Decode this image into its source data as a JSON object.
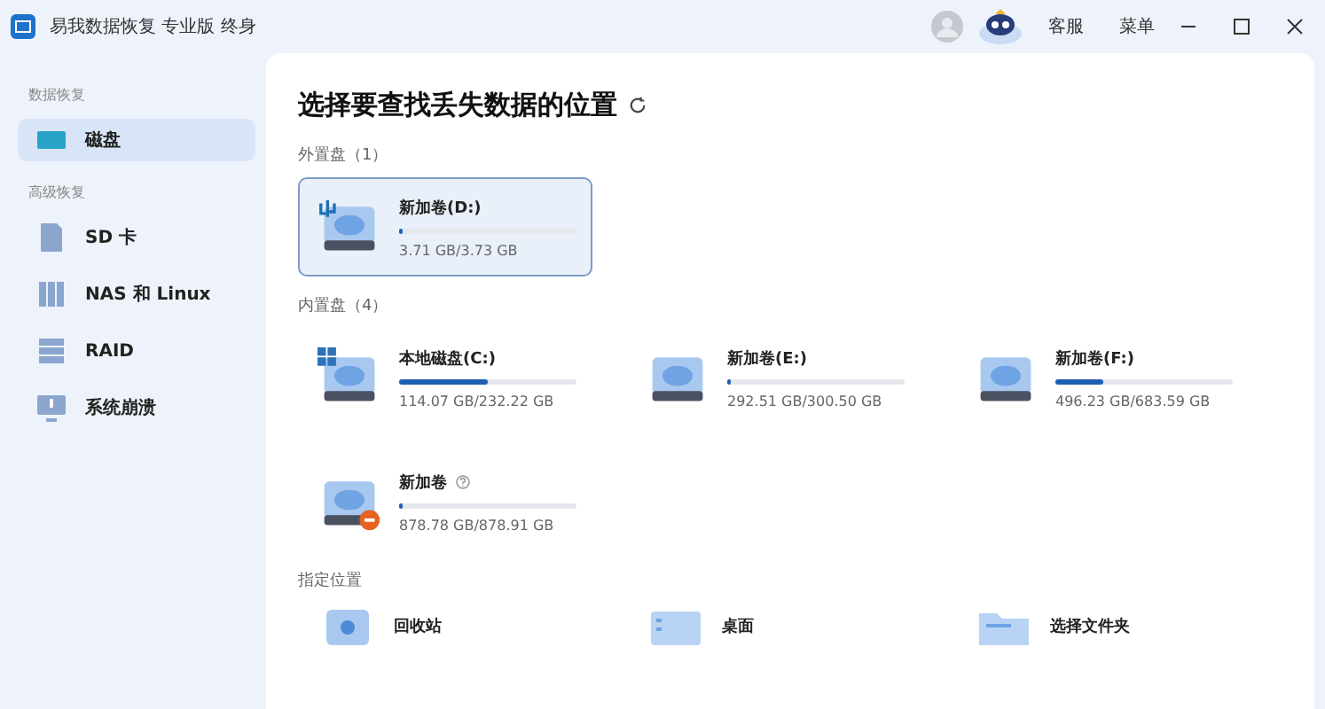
{
  "window": {
    "title": "易我数据恢复 专业版 终身",
    "actions": [
      "客服",
      "菜单"
    ]
  },
  "sidebar": {
    "sections": [
      {
        "title": "数据恢复",
        "items": [
          {
            "label": "磁盘",
            "kind": "disk",
            "selected": true
          }
        ]
      },
      {
        "title": "高级恢复",
        "items": [
          {
            "label": "SD 卡",
            "kind": "sd",
            "selected": false
          },
          {
            "label": "NAS 和 Linux",
            "kind": "nas",
            "selected": false
          },
          {
            "label": "RAID",
            "kind": "raid",
            "selected": false
          },
          {
            "label": "系统崩溃",
            "kind": "crash",
            "selected": false
          }
        ]
      }
    ]
  },
  "main": {
    "heading": "选择要查找丢失数据的位置",
    "groups": [
      {
        "title": "外置盘（1）",
        "drives": [
          {
            "name": "新加卷(D:)",
            "usage": "3.71 GB/3.73 GB",
            "level": 0.02,
            "kind": "usb",
            "selected": true,
            "help": false
          }
        ]
      },
      {
        "title": "内置盘（4）",
        "drives": [
          {
            "name": "本地磁盘(C:)",
            "usage": "114.07 GB/232.22 GB",
            "level": 0.5,
            "kind": "system",
            "selected": false,
            "help": false
          },
          {
            "name": "新加卷(E:)",
            "usage": "292.51 GB/300.50 GB",
            "level": 0.02,
            "kind": "plain",
            "selected": false,
            "help": false
          },
          {
            "name": "新加卷(F:)",
            "usage": "496.23 GB/683.59 GB",
            "level": 0.27,
            "kind": "plain",
            "selected": false,
            "help": false
          },
          {
            "name": "新加卷",
            "usage": "878.78 GB/878.91 GB",
            "level": 0.02,
            "kind": "error",
            "selected": false,
            "help": true
          }
        ]
      }
    ],
    "locations": {
      "title": "指定位置",
      "items": [
        {
          "label": "回收站",
          "kind": "recycle"
        },
        {
          "label": "桌面",
          "kind": "desktop"
        },
        {
          "label": "选择文件夹",
          "kind": "folder"
        }
      ]
    }
  }
}
